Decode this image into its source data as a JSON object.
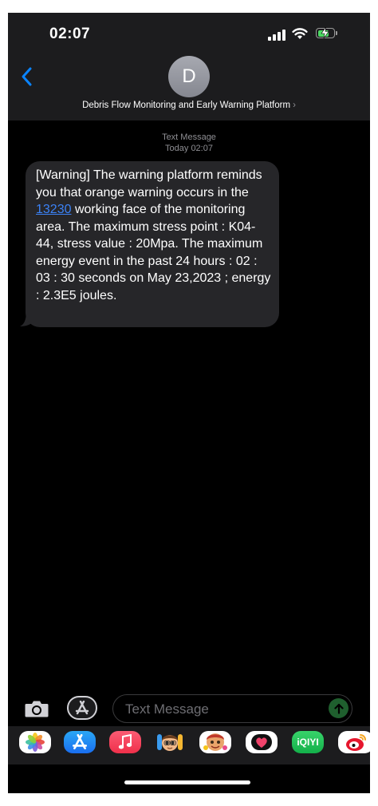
{
  "status_bar": {
    "time": "02:07"
  },
  "header": {
    "avatar_initial": "D",
    "contact_name": "Debris Flow Monitoring and Early Warning Platform",
    "chevron": "›"
  },
  "conversation": {
    "service_label": "Text Message",
    "timestamp": "Today 02:07",
    "message": {
      "part_before_link": "[Warning] The warning platform reminds you that orange warning occurs in the ",
      "link_text": "13230",
      "part_after_link": " working face of the monitoring area. The maximum stress point : K04-44, stress value : 20Mpa. The maximum energy event in the past 24 hours : 02 : 03 : 30 seconds on May 23,2023 ; energy : 2.3E5 joules."
    }
  },
  "compose": {
    "placeholder": "Text Message",
    "camera_icon": "camera-icon",
    "apps_icon": "app-store-icon",
    "send_icon": "arrow-up-icon"
  },
  "app_drawer": {
    "apps": [
      {
        "name": "photos",
        "icon": "photos-icon"
      },
      {
        "name": "app-store",
        "icon": "app-store-icon"
      },
      {
        "name": "music",
        "icon": "music-note-icon"
      },
      {
        "name": "memoji",
        "icon": "memoji-icon"
      },
      {
        "name": "animoji",
        "icon": "animoji-icon"
      },
      {
        "name": "digital-touch",
        "icon": "heart-icon"
      },
      {
        "name": "iqiyi",
        "label": "iQIYI"
      },
      {
        "name": "weibo",
        "icon": "weibo-icon"
      }
    ]
  },
  "colors": {
    "background": "#000000",
    "header": "#1c1c1e",
    "bubble": "#262629",
    "link": "#3b82f6",
    "accent_blue": "#0a84ff",
    "send_button": "#1f5f2e",
    "battery": "#4cd964"
  }
}
